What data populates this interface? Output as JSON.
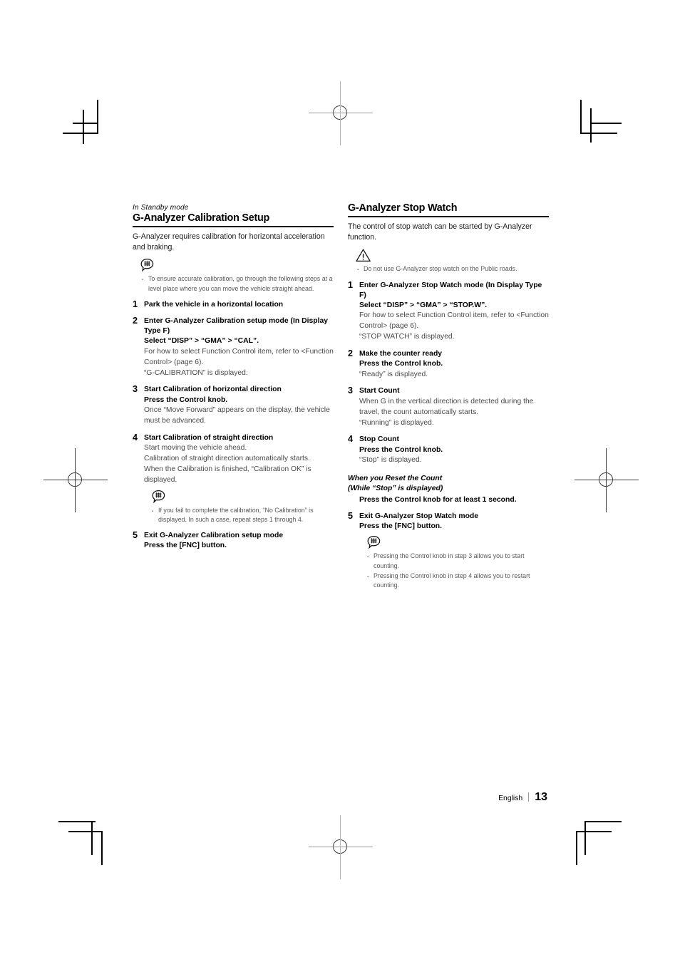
{
  "page": {
    "footer_language": "English",
    "footer_page_number": "13"
  },
  "left_column": {
    "kicker": "In Standby mode",
    "title": "G-Analyzer Calibration Setup",
    "lead": "G-Analyzer requires calibration for horizontal acceleration and braking.",
    "note_icon": "note-bubble-icon",
    "notes": [
      "To ensure accurate calibration, go through the following steps at a level place where you can move the vehicle straight ahead."
    ],
    "steps": [
      {
        "num": "1",
        "heading": "Park the vehicle in a horizontal location"
      },
      {
        "num": "2",
        "heading": "Enter G-Analyzer Calibration setup mode (In Display Type F)",
        "subheading": "Select “DISP” > “GMA” > “CAL”.",
        "body": "For how to select Function Control item, refer to <Function Control> (page 6).\n“G-CALIBRATION” is displayed."
      },
      {
        "num": "3",
        "heading": "Start Calibration of horizontal direction",
        "subheading": "Press the Control knob.",
        "body": "Once “Move Forward” appears on the display, the vehicle must be advanced."
      },
      {
        "num": "4",
        "heading": "Start Calibration of straight direction",
        "body": "Start moving the vehicle ahead.\nCalibration of straight direction automatically starts.\nWhen the Calibration is finished, “Calibration OK” is displayed.",
        "note_icon": "note-bubble-icon",
        "notes": [
          "If you fail to complete the calibration, “No Calibration” is displayed. In such a case, repeat steps 1 through 4."
        ]
      },
      {
        "num": "5",
        "heading": "Exit G-Analyzer Calibration setup mode",
        "subheading": "Press the [FNC] button."
      }
    ]
  },
  "right_column": {
    "title": "G-Analyzer Stop Watch",
    "lead": "The control of stop watch can be started by G-Analyzer function.",
    "caution_icon": "warning-triangle-icon",
    "cautions": [
      "Do not use G-Analyzer stop watch on the Public roads."
    ],
    "steps": [
      {
        "num": "1",
        "heading": "Enter G-Analyzer Stop Watch mode (In Display Type F)",
        "subheading": "Select “DISP” > “GMA” > “STOP.W”.",
        "body": "For how to select Function Control item, refer to <Function Control> (page 6).\n“STOP WATCH” is displayed."
      },
      {
        "num": "2",
        "heading": "Make the counter ready",
        "subheading": "Press the Control knob.",
        "body": "“Ready” is displayed."
      },
      {
        "num": "3",
        "heading": "Start Count",
        "body": "When G in the vertical direction is detected during the travel, the count automatically starts.\n“Running” is displayed."
      },
      {
        "num": "4",
        "heading": "Stop Count",
        "subheading": "Press the Control knob.",
        "body": "“Stop” is displayed."
      }
    ],
    "reset_subhead": "When you Reset the Count\n(While “Stop” is displayed)",
    "reset_body": "Press the Control knob for at least 1 second.",
    "final_step": {
      "num": "5",
      "heading": "Exit G-Analyzer Stop Watch mode",
      "subheading": "Press the [FNC] button."
    },
    "note_icon": "note-bubble-icon",
    "notes": [
      "Pressing the Control knob in step 3 allows you to start counting.",
      "Pressing the Control knob in step 4 allows you to restart counting."
    ]
  }
}
